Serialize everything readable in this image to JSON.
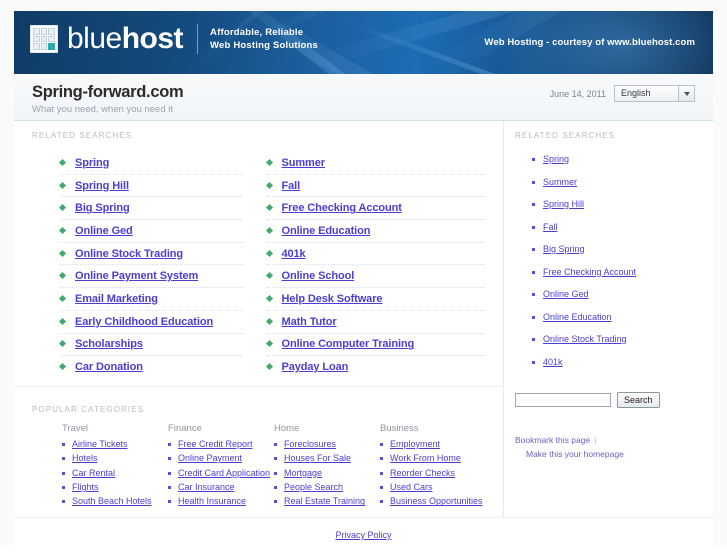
{
  "banner": {
    "logo_text_light": "blue",
    "logo_text_bold": "host",
    "tagline_line1": "Affordable, Reliable",
    "tagline_line2": "Web Hosting Solutions",
    "courtesy": "Web Hosting - courtesy of www.bluehost.com",
    "accent_color": "#1d6cb4",
    "logo_cell_color": "#2aa9ae"
  },
  "title_band": {
    "site_title": "Spring-forward.com",
    "site_subtitle": "What you need, when you need it",
    "date": "June 14, 2011",
    "language_selected": "English"
  },
  "main": {
    "related_searches_heading": "RELATED SEARCHES",
    "related_left": [
      "Spring",
      "Spring Hill",
      "Big Spring",
      "Online Ged",
      "Online Stock Trading",
      "Online Payment System",
      "Email Marketing",
      "Early Childhood Education",
      "Scholarships",
      "Car Donation"
    ],
    "related_right": [
      "Summer",
      "Fall",
      "Free Checking Account",
      "Online Education",
      "401k",
      "Online School",
      "Help Desk Software",
      "Math Tutor",
      "Online Computer Training",
      "Payday Loan"
    ],
    "popular_categories_heading": "POPULAR CATEGORIES",
    "categories": [
      {
        "title": "Travel",
        "items": [
          "Airline Tickets",
          "Hotels",
          "Car Rental",
          "Flights",
          "South Beach Hotels"
        ]
      },
      {
        "title": "Finance",
        "items": [
          "Free Credit Report",
          "Online Payment",
          "Credit Card Application",
          "Car Insurance",
          "Health Insurance"
        ]
      },
      {
        "title": "Home",
        "items": [
          "Foreclosures",
          "Houses For Sale",
          "Mortgage",
          "People Search",
          "Real Estate Training"
        ]
      },
      {
        "title": "Business",
        "items": [
          "Employment",
          "Work From Home",
          "Reorder Checks",
          "Used Cars",
          "Business Opportunities"
        ]
      }
    ]
  },
  "sidebar": {
    "related_searches_heading": "RELATED SEARCHES",
    "items": [
      "Spring",
      "Summer",
      "Spring Hill",
      "Fall",
      "Big Spring",
      "Free Checking Account",
      "Online Ged",
      "Online Education",
      "Online Stock Trading",
      "401k"
    ],
    "search_value": "",
    "search_placeholder": "",
    "search_button": "Search",
    "bookmark_link": "Bookmark this page",
    "homepage_link": "Make this your homepage",
    "link_color": "#4b3fd0"
  },
  "footer": {
    "privacy_policy": "Privacy Policy"
  }
}
